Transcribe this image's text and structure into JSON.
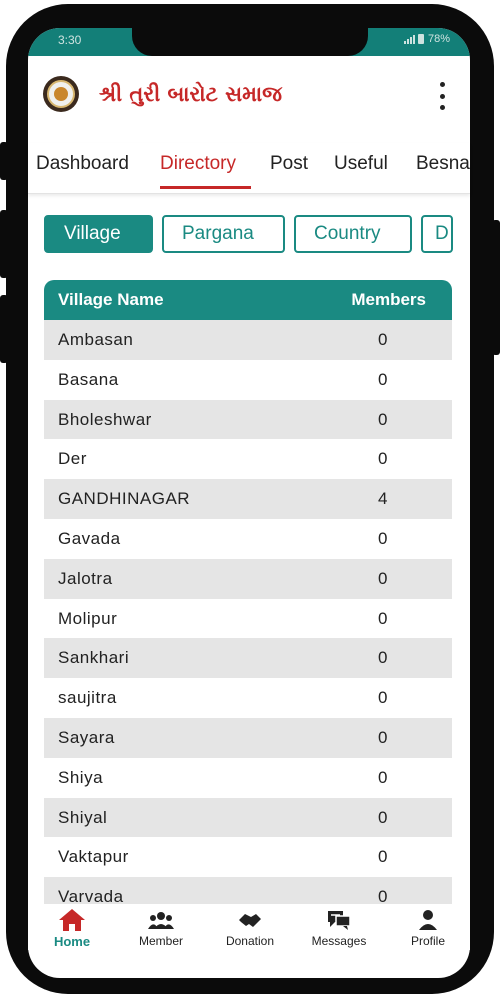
{
  "status": {
    "time": "3:30",
    "battery": "78%"
  },
  "app": {
    "title": "શ્રી તુરી બારોટ સમાજ"
  },
  "tabs": [
    {
      "label": "Dashboard"
    },
    {
      "label": "Directory"
    },
    {
      "label": "Post"
    },
    {
      "label": "Useful"
    },
    {
      "label": "Besna"
    }
  ],
  "filters": [
    {
      "label": "Village"
    },
    {
      "label": "Pargana"
    },
    {
      "label": "Country"
    },
    {
      "label": "D"
    }
  ],
  "table": {
    "headers": {
      "name": "Village Name",
      "members": "Members"
    },
    "rows": [
      {
        "name": "Ambasan",
        "members": "0"
      },
      {
        "name": "Basana",
        "members": "0"
      },
      {
        "name": "Bholeshwar",
        "members": "0"
      },
      {
        "name": "Der",
        "members": "0"
      },
      {
        "name": "GANDHINAGAR",
        "members": "4"
      },
      {
        "name": "Gavada",
        "members": "0"
      },
      {
        "name": "Jalotra",
        "members": "0"
      },
      {
        "name": "Molipur",
        "members": "0"
      },
      {
        "name": "Sankhari",
        "members": "0"
      },
      {
        "name": "saujitra",
        "members": "0"
      },
      {
        "name": "Sayara",
        "members": "0"
      },
      {
        "name": "Shiya",
        "members": "0"
      },
      {
        "name": "Shiyal",
        "members": "0"
      },
      {
        "name": "Vaktapur",
        "members": "0"
      },
      {
        "name": "Varvada",
        "members": "0"
      }
    ]
  },
  "bottom_nav": [
    {
      "label": "Home",
      "icon": "home-icon"
    },
    {
      "label": "Member",
      "icon": "group-icon"
    },
    {
      "label": "Donation",
      "icon": "handshake-icon"
    },
    {
      "label": "Messages",
      "icon": "chat-icon"
    },
    {
      "label": "Profile",
      "icon": "person-icon"
    }
  ],
  "colors": {
    "primary": "#1a8a82",
    "accent": "#c62828",
    "row_alt": "#e5e5e5"
  }
}
